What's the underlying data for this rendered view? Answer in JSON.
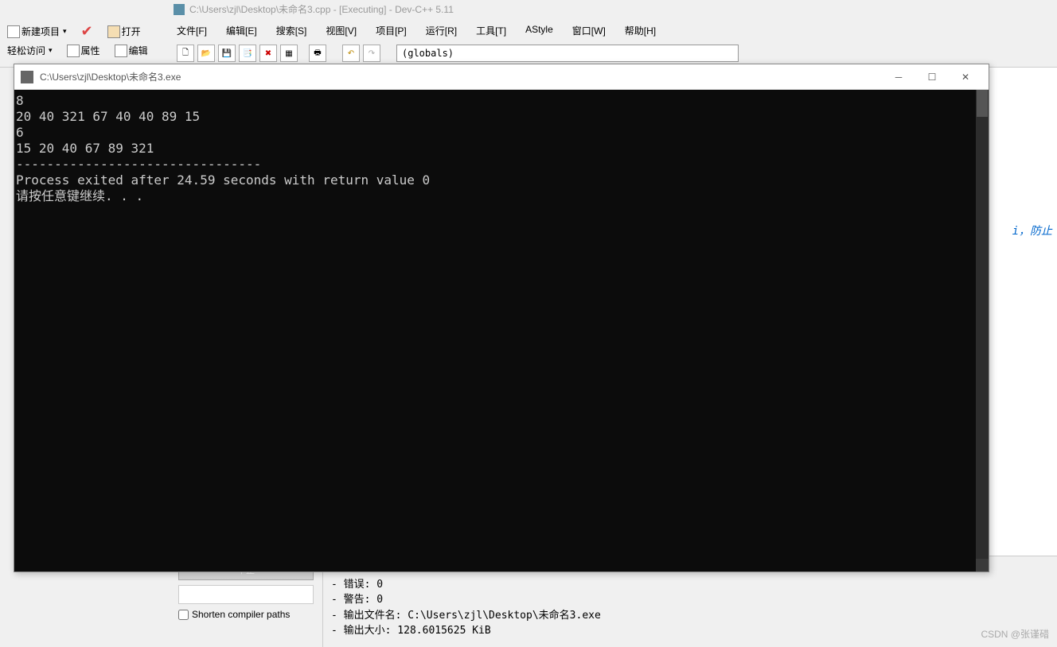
{
  "ide": {
    "title": "C:\\Users\\zjl\\Desktop\\未命名3.cpp - [Executing] - Dev-C++ 5.11",
    "menus": [
      "文件[F]",
      "编辑[E]",
      "搜索[S]",
      "视图[V]",
      "项目[P]",
      "运行[R]",
      "工具[T]",
      "AStyle",
      "窗口[W]",
      "帮助[H]"
    ],
    "left_toolbar": {
      "new_project": "新建项目",
      "quick_access": "轻松访问",
      "open": "打开",
      "properties": "属性",
      "edit": "编辑"
    },
    "scope": "(globals)",
    "abort_btn": "中止",
    "shorten_label": "Shorten compiler paths",
    "code_comment": "i，防止"
  },
  "console": {
    "title": "C:\\Users\\zjl\\Desktop\\未命名3.exe",
    "lines": [
      "8",
      "20 40 321 67 40 40 89 15",
      "6",
      "15 20 40 67 89 321",
      "--------------------------------",
      "Process exited after 24.59 seconds with return value 0",
      "请按任意键继续. . ."
    ]
  },
  "compiler_output": {
    "line1_prefix": "------",
    "line2": "- 错误: 0",
    "line3": "- 警告: 0",
    "line4": "- 输出文件名: C:\\Users\\zjl\\Desktop\\未命名3.exe",
    "line5": "- 输出大小: 128.6015625 KiB"
  },
  "watermark": "CSDN @张谨碏"
}
